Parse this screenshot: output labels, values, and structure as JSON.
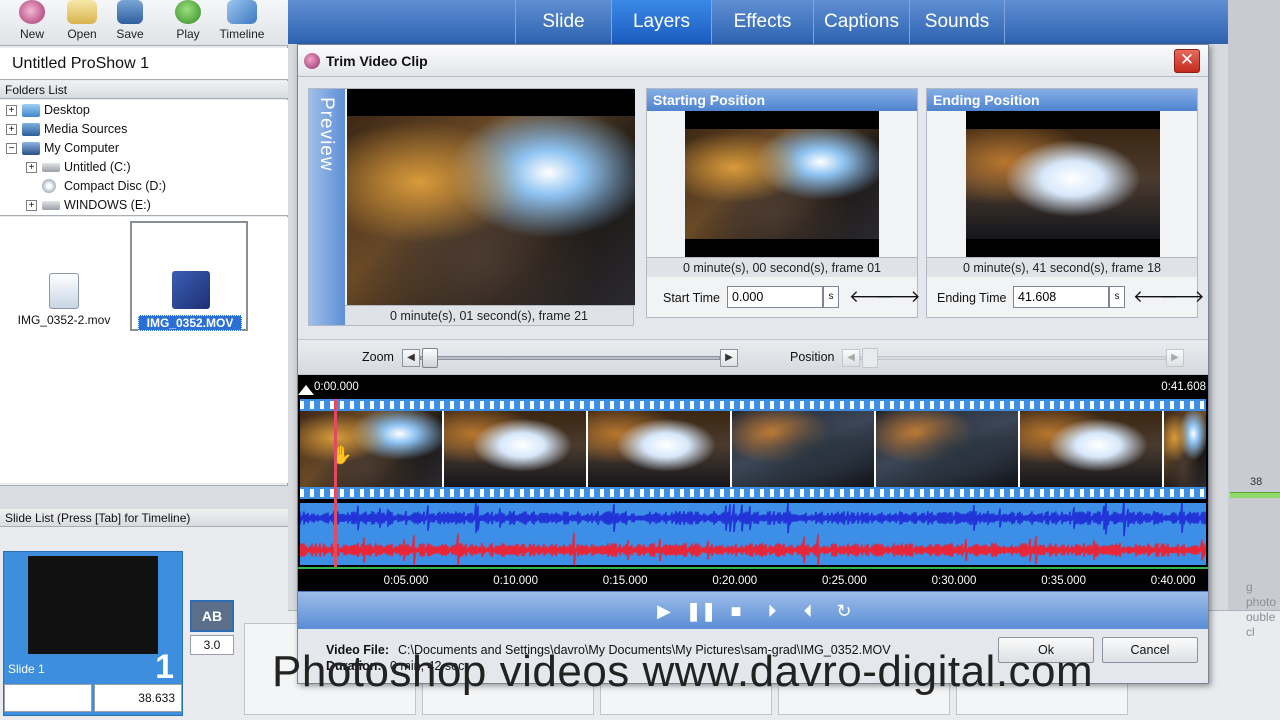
{
  "toolbar": {
    "new": "New",
    "open": "Open",
    "save": "Save",
    "play": "Play",
    "timeline": "Timeline"
  },
  "show_title": "Untitled ProShow 1",
  "folders": {
    "header": "Folders List",
    "items": [
      {
        "label": "Desktop",
        "icon": "desktop-icon"
      },
      {
        "label": "Media Sources",
        "icon": "media-sources-icon"
      },
      {
        "label": "My Computer",
        "icon": "computer-icon"
      },
      {
        "label": "Untitled (C:)",
        "icon": "drive-icon"
      },
      {
        "label": "Compact Disc (D:)",
        "icon": "cd-icon"
      },
      {
        "label": "WINDOWS (E:)",
        "icon": "drive-icon"
      }
    ]
  },
  "files": [
    {
      "name": "IMG_0352-2.mov",
      "selected": false
    },
    {
      "name": "IMG_0352.MOV",
      "selected": true
    }
  ],
  "slide_list": {
    "header": "Slide List (Press [Tab] for Timeline)",
    "slide_name": "Slide 1",
    "slide_number": "1",
    "slide_duration": "38.633",
    "transition_label": "AB",
    "transition_time": "3.0"
  },
  "tabs": [
    "Slide",
    "Layers",
    "Effects",
    "Captions",
    "Sounds"
  ],
  "active_tab": "Layers",
  "background": {
    "marker": "38",
    "drag_text_line1": "g photo",
    "drag_text_line2": "ouble cl"
  },
  "dialog": {
    "title": "Trim Video Clip",
    "close": "✕",
    "preview": {
      "vertical_label": "Preview",
      "caption": "0 minute(s), 01 second(s), frame 21"
    },
    "start": {
      "header": "Starting Position",
      "caption": "0 minute(s), 00 second(s), frame 01",
      "time_label": "Start Time",
      "time_value": "0.000",
      "unit": "s"
    },
    "end": {
      "header": "Ending Position",
      "caption": "0 minute(s), 41 second(s), frame 18",
      "time_label": "Ending Time",
      "time_value": "41.608",
      "unit": "s"
    },
    "zoom_label": "Zoom",
    "position_label": "Position",
    "timeline": {
      "start": "0:00.000",
      "end": "0:41.608",
      "ticks": [
        "0:05.000",
        "0:10.000",
        "0:15.000",
        "0:20.000",
        "0:25.000",
        "0:30.000",
        "0:35.000",
        "0:40.000"
      ]
    },
    "footer": {
      "video_file_label": "Video File:",
      "video_file_path": "C:\\Documents and Settings\\davro\\My Documents\\My Pictures\\sam-grad\\IMG_0352.MOV",
      "duration_label": "Duration:",
      "duration_value": "0 min, 42 sec",
      "ok": "Ok",
      "cancel": "Cancel"
    }
  },
  "watermark": "Photoshop videos  www.davro-digital.com",
  "colors": {
    "accent_blue": "#3c8ee6",
    "waveform_top": "#2233d8",
    "waveform_bottom": "#e8263a",
    "close_red": "#c3291e"
  }
}
